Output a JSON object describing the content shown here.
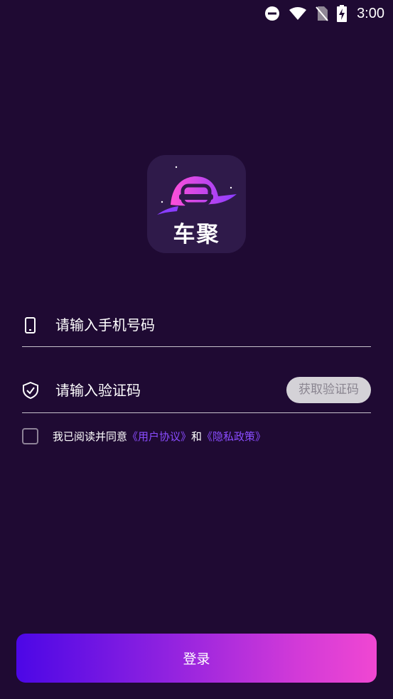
{
  "status_bar": {
    "time": "3:00",
    "icons": [
      "do-not-disturb-icon",
      "wifi-icon",
      "no-sim-icon",
      "battery-charging-icon"
    ]
  },
  "logo": {
    "text": "车聚",
    "colors": {
      "tile": "#2f1a4a",
      "gradient_start": "#ff4fd8",
      "gradient_end": "#8a3dff"
    }
  },
  "login_form": {
    "phone": {
      "icon": "phone-icon",
      "placeholder": "请输入手机号码",
      "value": ""
    },
    "code": {
      "icon": "shield-check-icon",
      "placeholder": "请输入验证码",
      "value": "",
      "get_code_label": "获取验证码"
    },
    "agreement": {
      "checked": false,
      "prefix": "我已阅读并同意",
      "user_agreement": "《用户协议》",
      "conjunction": "和",
      "privacy_policy": "《隐私政策》"
    },
    "submit_label": "登录"
  },
  "theme": {
    "background": "#1f0a33",
    "link_color": "#8a4cff",
    "button_gradient": [
      "#4c07e6",
      "#f047d2"
    ]
  }
}
